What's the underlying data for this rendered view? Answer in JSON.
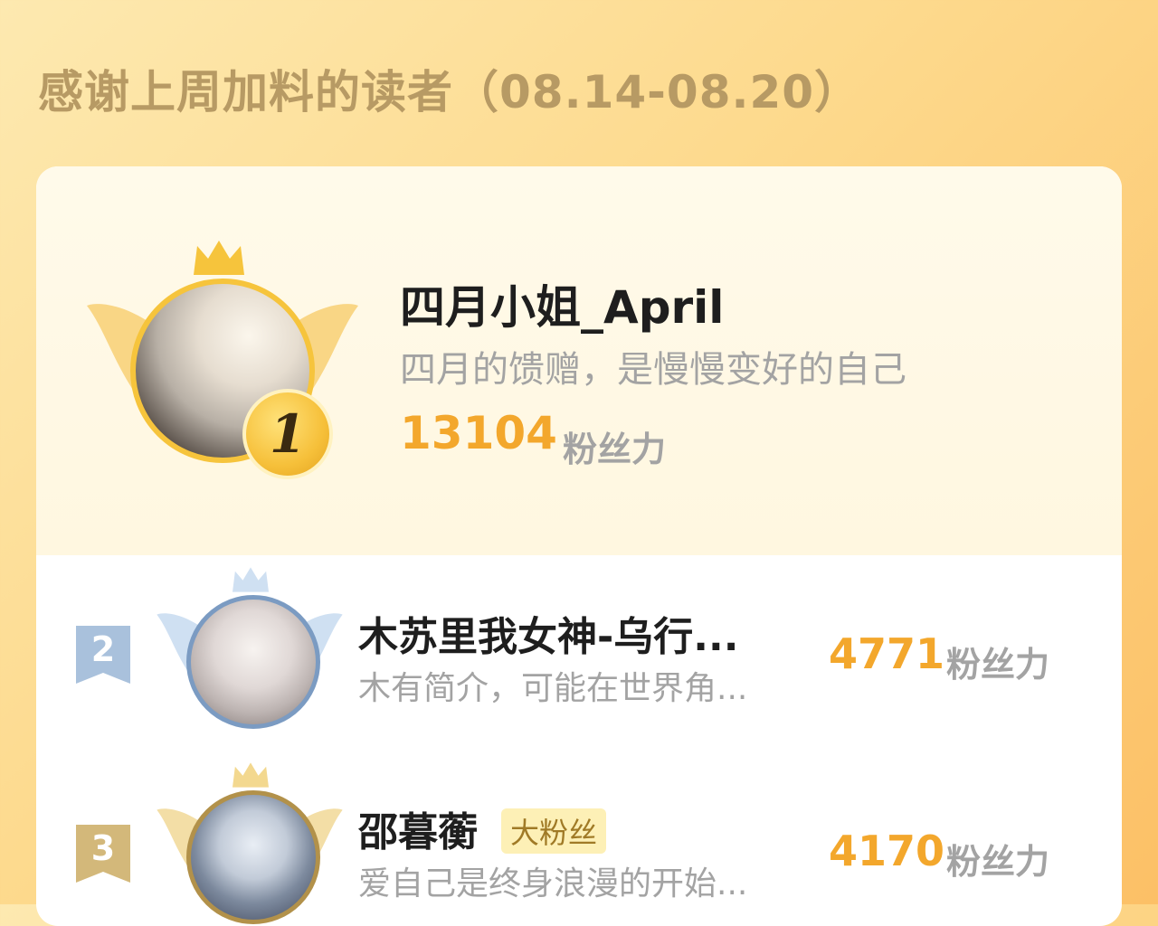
{
  "heading": "感谢上周加料的读者（08.14-08.20）",
  "colors": {
    "accent": "#f3a72c",
    "gold": "#f6c03a",
    "silver": "#a9c1dc",
    "bronze": "#d3b87a"
  },
  "top_reader": {
    "rank": "1",
    "name": "四月小姐_April",
    "bio": "四月的馈赠，是慢慢变好的自己",
    "score": "13104",
    "unit": "粉丝力"
  },
  "readers": [
    {
      "rank": "2",
      "name": "木苏里我女神-乌行...",
      "bio": "木有简介，可能在世界角...",
      "score": "4771",
      "unit": "粉丝力",
      "badge": ""
    },
    {
      "rank": "3",
      "name": "邵暮蘅",
      "bio": "爱自己是终身浪漫的开始...",
      "score": "4170",
      "unit": "粉丝力",
      "badge": "大粉丝"
    }
  ]
}
